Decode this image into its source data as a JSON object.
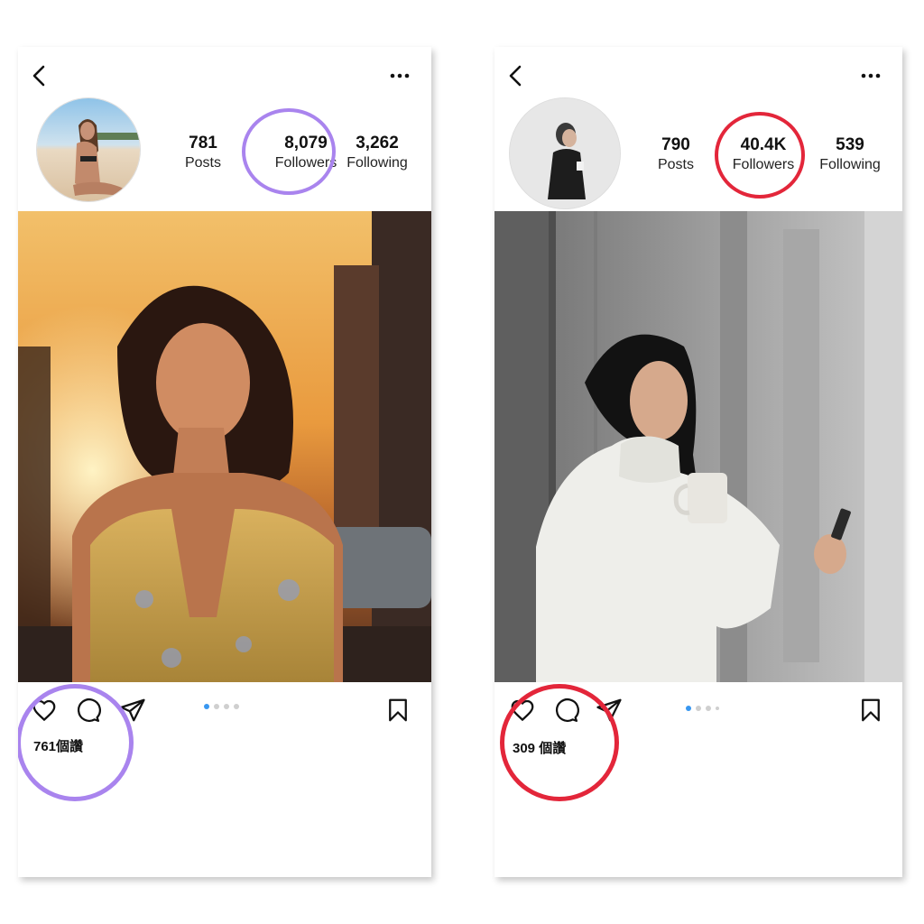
{
  "colors": {
    "ring_left": "#a984ee",
    "ring_right": "#e3263a",
    "dot_active": "#3897f0",
    "dot_inactive": "#cfcfcf"
  },
  "icons": {
    "back": "chevron-left-icon",
    "more": "ellipsis-icon",
    "like": "heart-icon",
    "comment": "comment-bubble-icon",
    "share": "paper-plane-icon",
    "save": "bookmark-icon"
  },
  "profiles": [
    {
      "posts": {
        "value": "781",
        "label": "Posts"
      },
      "followers": {
        "value": "8,079",
        "label": "Followers"
      },
      "following": {
        "value": "3,262",
        "label": "Following"
      },
      "likes": "761個讚",
      "carousel": {
        "count": 4,
        "active": 0
      }
    },
    {
      "posts": {
        "value": "790",
        "label": "Posts"
      },
      "followers": {
        "value": "40.4K",
        "label": "Followers"
      },
      "following": {
        "value": "539",
        "label": "Following"
      },
      "likes": "309 個讚",
      "carousel": {
        "count": 4,
        "active": 0
      }
    }
  ]
}
